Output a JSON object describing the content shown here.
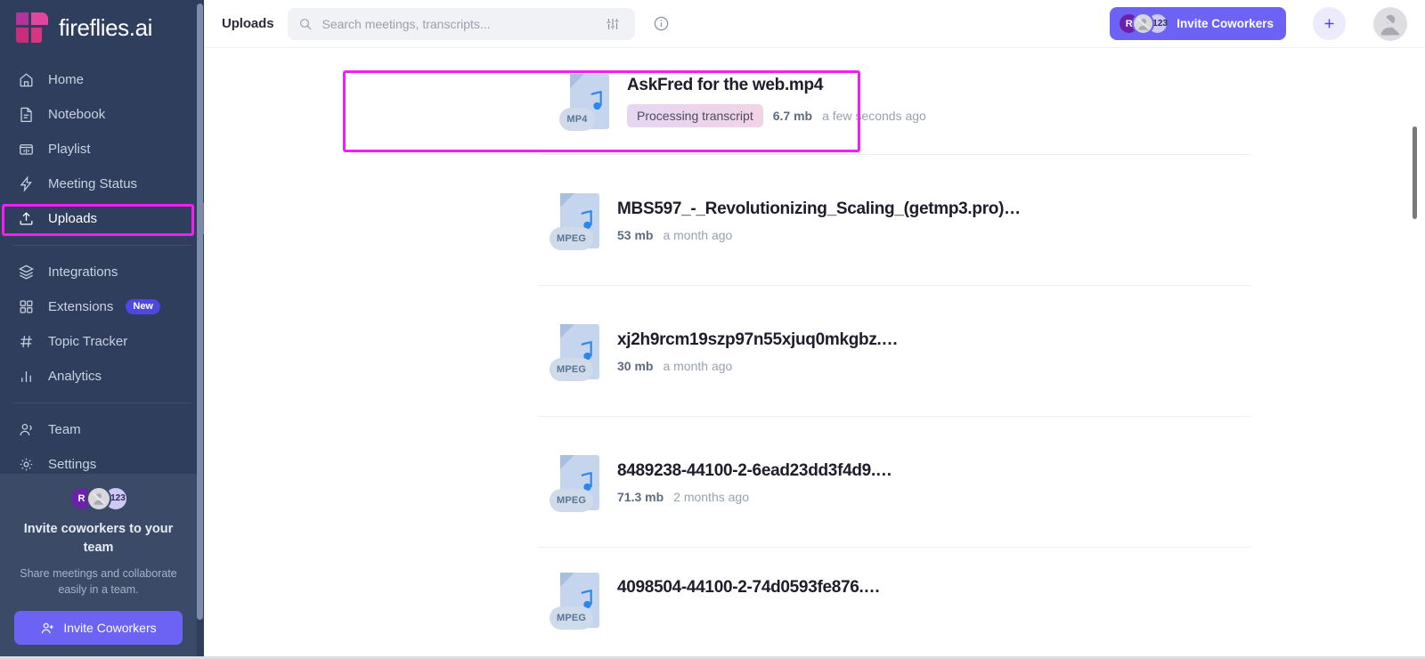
{
  "brand": {
    "name": "fireflies.ai",
    "logo_icon": "fireflies-logo-icon"
  },
  "sidebar": {
    "items": [
      {
        "label": "Home",
        "icon": "home-icon",
        "active": false
      },
      {
        "label": "Notebook",
        "icon": "notebook-icon",
        "active": false
      },
      {
        "label": "Playlist",
        "icon": "playlist-icon",
        "active": false
      },
      {
        "label": "Meeting Status",
        "icon": "lightning-bolt-icon",
        "active": false
      },
      {
        "label": "Uploads",
        "icon": "upload-icon",
        "active": true
      },
      {
        "label": "Integrations",
        "icon": "layers-icon",
        "active": false
      },
      {
        "label": "Extensions",
        "icon": "grid-icon",
        "active": false,
        "badge": "New"
      },
      {
        "label": "Topic Tracker",
        "icon": "hash-icon",
        "active": false
      },
      {
        "label": "Analytics",
        "icon": "bar-chart-icon",
        "active": false
      },
      {
        "label": "Team",
        "icon": "people-icon",
        "active": false
      },
      {
        "label": "Settings",
        "icon": "gear-icon",
        "active": false
      }
    ],
    "invite_panel": {
      "title": "Invite coworkers to your team",
      "subtitle": "Share meetings and collaborate easily in a team.",
      "button_label": "Invite Coworkers",
      "avatars": [
        {
          "type": "initial",
          "label": "R"
        },
        {
          "type": "ghost",
          "label": ""
        },
        {
          "type": "count",
          "label": "+123"
        }
      ]
    }
  },
  "topbar": {
    "page_title": "Uploads",
    "search": {
      "placeholder": "Search meetings, transcripts...",
      "value": ""
    },
    "filter_icon": "filter-sliders-icon",
    "info_icon": "info-circle-icon",
    "invite_label": "Invite Coworkers",
    "invite_avatars": [
      {
        "type": "initial",
        "label": "R"
      },
      {
        "type": "ghost",
        "label": ""
      },
      {
        "type": "count",
        "label": "+123"
      }
    ],
    "add_icon": "plus-icon",
    "avatar_icon": "user-avatar-icon"
  },
  "uploads": [
    {
      "name": "AskFred for the web.mp4",
      "format": "MP4",
      "status": "Processing transcript",
      "size": "6.7 mb",
      "time": "a few seconds ago",
      "highlighted": true
    },
    {
      "name": "MBS597_-_Revolutionizing_Scaling_(getmp3.pro)…",
      "format": "MPEG",
      "status": "",
      "size": "53 mb",
      "time": "a month ago",
      "highlighted": false
    },
    {
      "name": "xj2h9rcm19szp97n55xjuq0mkgbz.…",
      "format": "MPEG",
      "status": "",
      "size": "30 mb",
      "time": "a month ago",
      "highlighted": false
    },
    {
      "name": "8489238-44100-2-6ead23dd3f4d9.…",
      "format": "MPEG",
      "status": "",
      "size": "71.3 mb",
      "time": "2 months ago",
      "highlighted": false
    },
    {
      "name": "4098504-44100-2-74d0593fe876.…",
      "format": "MPEG",
      "status": "",
      "size": "",
      "time": "",
      "highlighted": false
    }
  ],
  "colors": {
    "sidebar_bg": "#2e3e5c",
    "accent_purple": "#6c63f5",
    "highlight_magenta": "#f41df4",
    "brand_pink": "#d6357f",
    "file_blue": "#c5d5ee"
  }
}
